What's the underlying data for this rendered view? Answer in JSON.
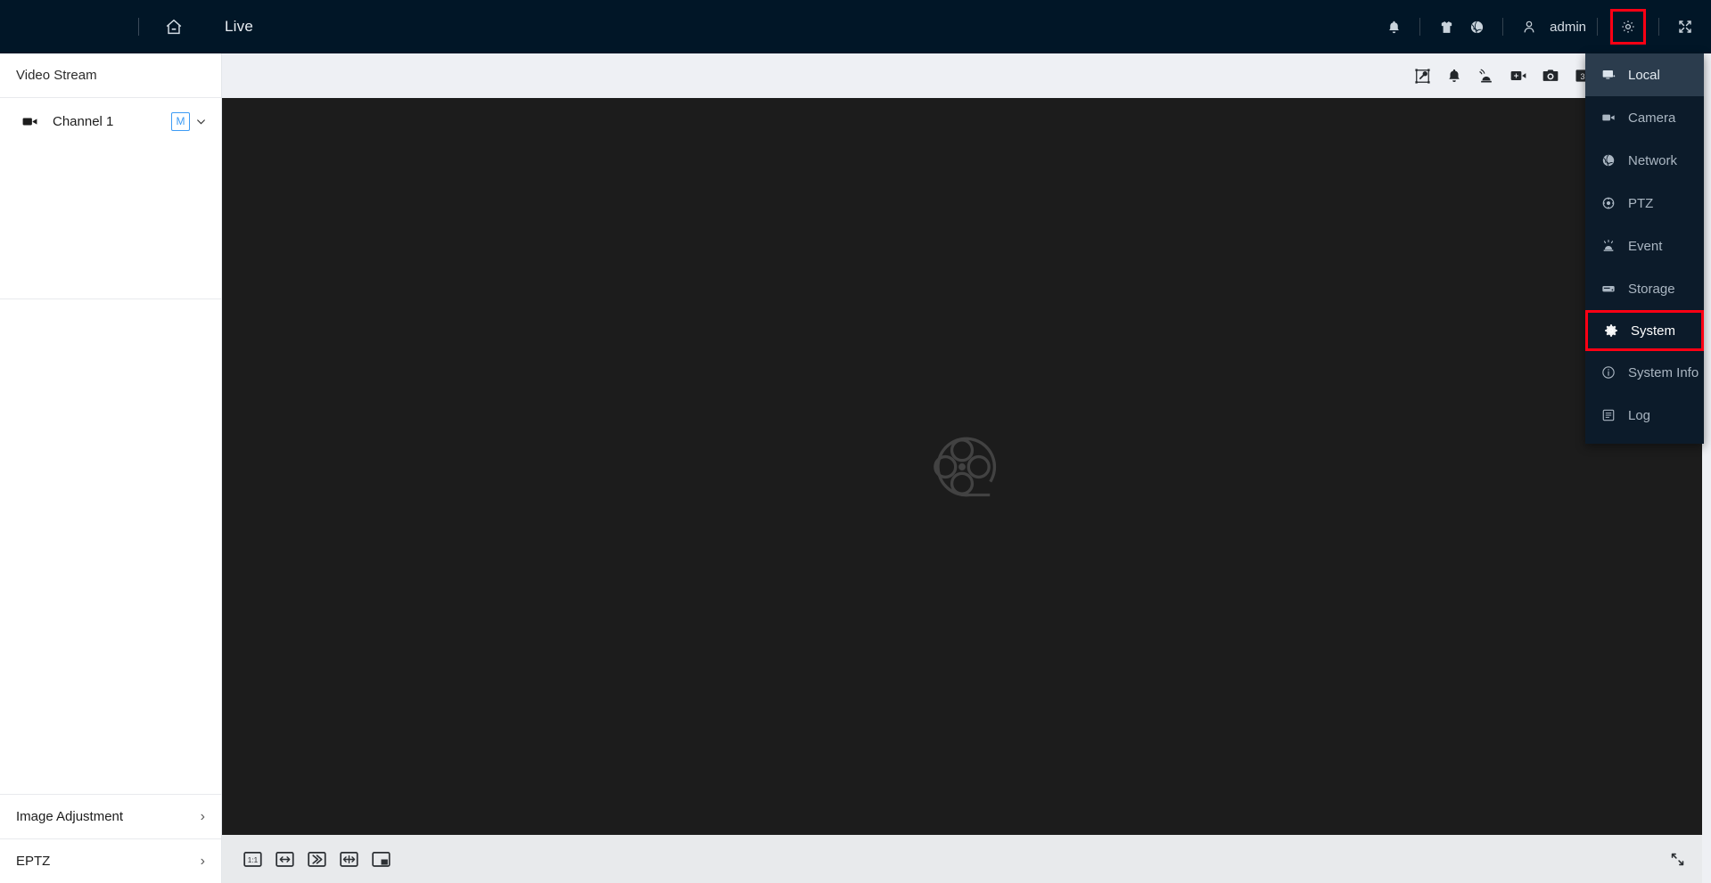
{
  "header": {
    "home_icon": "home-icon",
    "page_title": "Live",
    "bell_icon": "bell-icon",
    "shirt_icon": "shirt-icon",
    "globe_icon": "globe-icon",
    "user_icon": "user-icon",
    "username": "admin",
    "gear_icon": "gear-icon",
    "fullscreen_icon": "fullscreen-expand-icon",
    "highlight_color": "#ff0014"
  },
  "sidebar": {
    "title": "Video Stream",
    "channel": {
      "icon": "video-camera-icon",
      "label": "Channel 1",
      "stream_badge": "M",
      "caret_icon": "chevron-down-icon"
    },
    "bottom_rows": [
      {
        "label": "Image Adjustment",
        "chevron": "›"
      },
      {
        "label": "EPTZ",
        "chevron": "›"
      }
    ]
  },
  "video_toolbar": {
    "icons": [
      "ptz-tool-icon",
      "bell-alert-icon",
      "alarm-siren-icon",
      "record-add-icon",
      "snapshot-camera-icon",
      "stream-count-3-icon",
      "monitor-local-icon",
      "speaker-icon",
      "microphone-icon"
    ],
    "stream_count_badge": "3"
  },
  "video": {
    "placeholder_icon": "film-reel-icon",
    "background_color": "#1c1c1c"
  },
  "bottom_toolbar": {
    "icons": [
      "aspect-ratio-1-1-icon",
      "fit-to-window-icon",
      "fluency-icon",
      "stretch-width-icon",
      "picture-in-picture-icon"
    ],
    "fullscreen_icon": "fullscreen-corner-icon"
  },
  "menu": {
    "items": [
      {
        "label": "Local",
        "icon": "monitor-icon",
        "state": "hovered"
      },
      {
        "label": "Camera",
        "icon": "video-camera-icon",
        "state": "normal"
      },
      {
        "label": "Network",
        "icon": "globe-icon",
        "state": "normal"
      },
      {
        "label": "PTZ",
        "icon": "ptz-icon",
        "state": "normal"
      },
      {
        "label": "Event",
        "icon": "alarm-icon",
        "state": "normal"
      },
      {
        "label": "Storage",
        "icon": "storage-icon",
        "state": "normal"
      },
      {
        "label": "System",
        "icon": "gear-icon",
        "state": "selected"
      },
      {
        "label": "System Info",
        "icon": "info-icon",
        "state": "normal"
      },
      {
        "label": "Log",
        "icon": "log-icon",
        "state": "normal"
      }
    ],
    "selected_outline_color": "#ff0014",
    "background_color": "#0c1b2a"
  }
}
